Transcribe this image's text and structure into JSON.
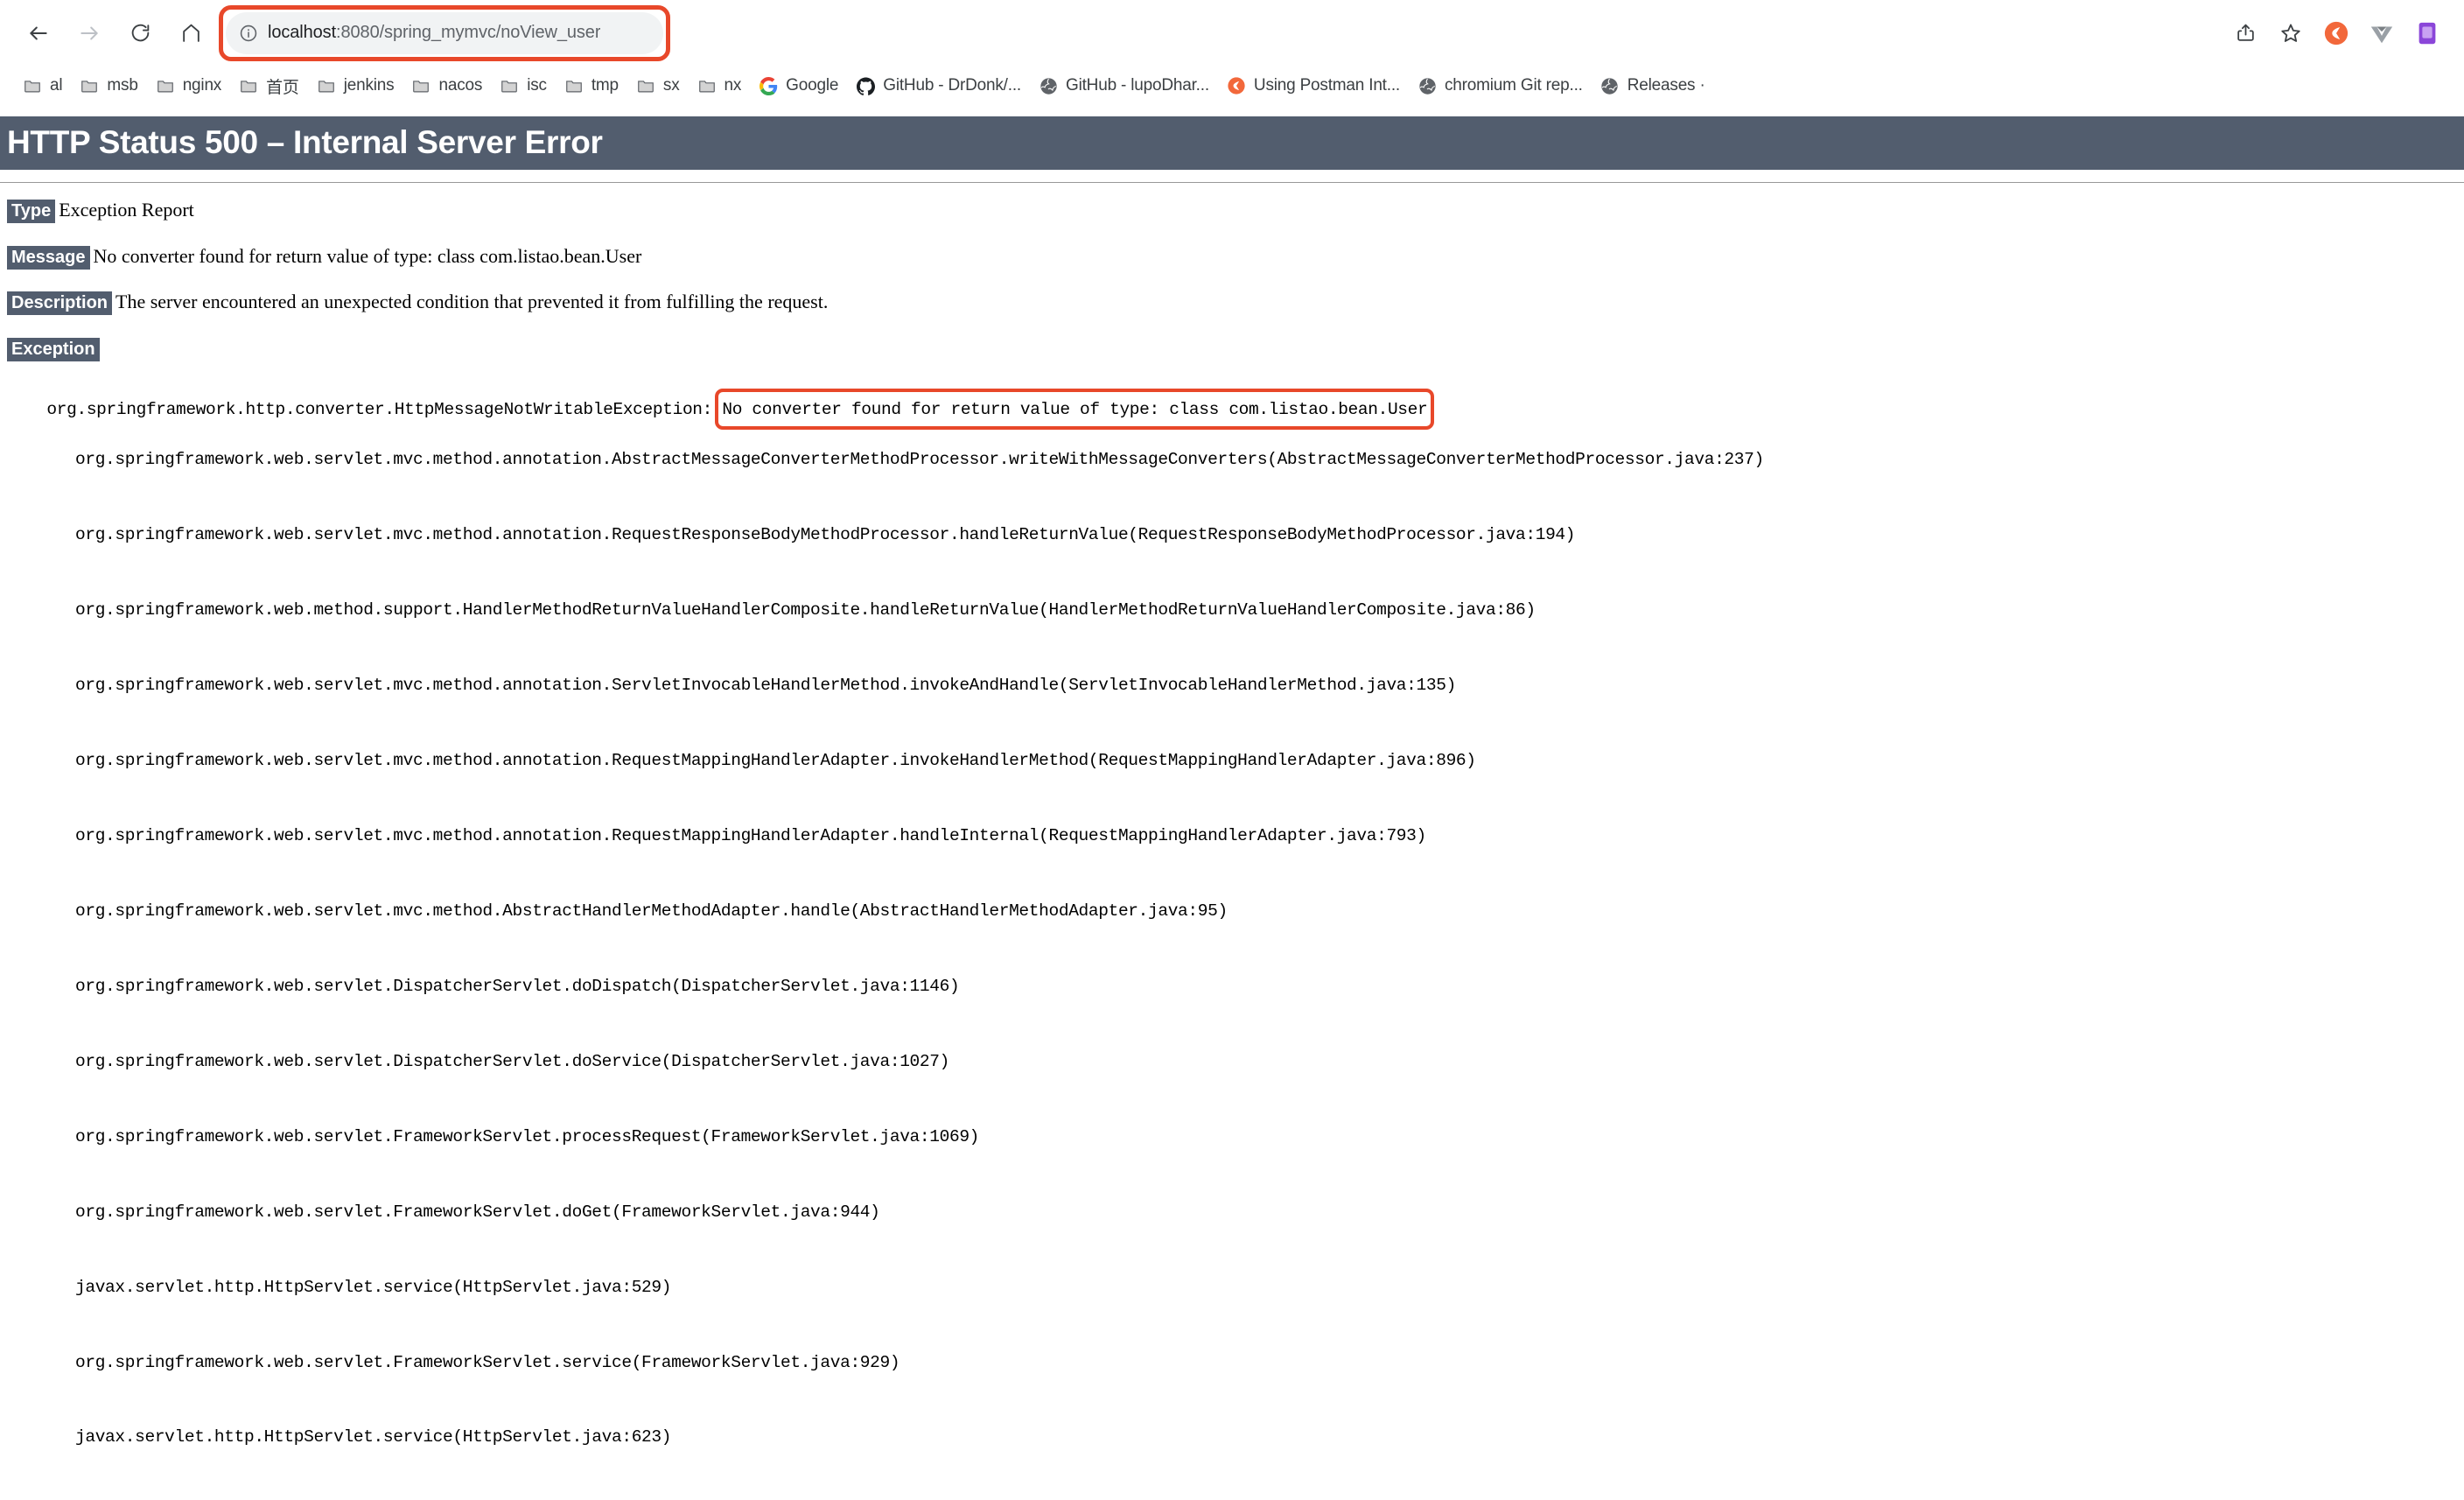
{
  "browser": {
    "nav": {
      "back_label": "Back",
      "forward_label": "Forward",
      "reload_label": "Reload",
      "home_label": "Home"
    },
    "omnibox": {
      "site_info_icon": "info-circle-icon",
      "url_host": "localhost",
      "url_rest": ":8080/spring_mymvc/noView_user",
      "full_url": "localhost:8080/spring_mymvc/noView_user",
      "highlight_color": "#e8482a"
    },
    "toolbar_right": [
      {
        "name": "share-icon",
        "label": "Share"
      },
      {
        "name": "bookmark-star-icon",
        "label": "Bookmark this tab"
      },
      {
        "name": "postman-extension-icon",
        "label": "Postman"
      },
      {
        "name": "vue-devtools-extension-icon",
        "label": "Vue.js devtools"
      },
      {
        "name": "purple-extension-icon",
        "label": "Extension"
      }
    ],
    "bookmarks": [
      {
        "label": "al",
        "icon": "folder-icon"
      },
      {
        "label": "msb",
        "icon": "folder-icon"
      },
      {
        "label": "nginx",
        "icon": "folder-icon"
      },
      {
        "label": "首页",
        "icon": "folder-icon"
      },
      {
        "label": "jenkins",
        "icon": "folder-icon"
      },
      {
        "label": "nacos",
        "icon": "folder-icon"
      },
      {
        "label": "isc",
        "icon": "folder-icon"
      },
      {
        "label": "tmp",
        "icon": "folder-icon"
      },
      {
        "label": "sx",
        "icon": "folder-icon"
      },
      {
        "label": "nx",
        "icon": "folder-icon"
      },
      {
        "label": "Google",
        "icon": "google-icon"
      },
      {
        "label": "GitHub - DrDonk/...",
        "icon": "github-icon"
      },
      {
        "label": "GitHub - lupoDhar...",
        "icon": "globe-icon"
      },
      {
        "label": "Using Postman Int...",
        "icon": "postman-icon"
      },
      {
        "label": "chromium Git rep...",
        "icon": "globe-icon"
      },
      {
        "label": "Releases ·",
        "icon": "globe-icon"
      }
    ]
  },
  "error_page": {
    "title": "HTTP Status 500 – Internal Server Error",
    "type_label": "Type",
    "type_value": "Exception Report",
    "message_label": "Message",
    "message_value": "No converter found for return value of type: class com.listao.bean.User",
    "description_label": "Description",
    "description_value": "The server encountered an unexpected condition that prevented it from fulfilling the request.",
    "exception_label": "Exception",
    "exception_class": "org.springframework.http.converter.HttpMessageNotWritableException:",
    "exception_message": "No converter found for return value of type: class com.listao.bean.User",
    "stack_trace": [
      "org.springframework.web.servlet.mvc.method.annotation.AbstractMessageConverterMethodProcessor.writeWithMessageConverters(AbstractMessageConverterMethodProcessor.java:237)",
      "org.springframework.web.servlet.mvc.method.annotation.RequestResponseBodyMethodProcessor.handleReturnValue(RequestResponseBodyMethodProcessor.java:194)",
      "org.springframework.web.method.support.HandlerMethodReturnValueHandlerComposite.handleReturnValue(HandlerMethodReturnValueHandlerComposite.java:86)",
      "org.springframework.web.servlet.mvc.method.annotation.ServletInvocableHandlerMethod.invokeAndHandle(ServletInvocableHandlerMethod.java:135)",
      "org.springframework.web.servlet.mvc.method.annotation.RequestMappingHandlerAdapter.invokeHandlerMethod(RequestMappingHandlerAdapter.java:896)",
      "org.springframework.web.servlet.mvc.method.annotation.RequestMappingHandlerAdapter.handleInternal(RequestMappingHandlerAdapter.java:793)",
      "org.springframework.web.servlet.mvc.method.AbstractHandlerMethodAdapter.handle(AbstractHandlerMethodAdapter.java:95)",
      "org.springframework.web.servlet.DispatcherServlet.doDispatch(DispatcherServlet.java:1146)",
      "org.springframework.web.servlet.DispatcherServlet.doService(DispatcherServlet.java:1027)",
      "org.springframework.web.servlet.FrameworkServlet.processRequest(FrameworkServlet.java:1069)",
      "org.springframework.web.servlet.FrameworkServlet.doGet(FrameworkServlet.java:944)",
      "javax.servlet.http.HttpServlet.service(HttpServlet.java:529)",
      "org.springframework.web.servlet.FrameworkServlet.service(FrameworkServlet.java:929)",
      "javax.servlet.http.HttpServlet.service(HttpServlet.java:623)"
    ],
    "header_bg_color": "#525D6E",
    "highlight_color": "#e8482a"
  }
}
